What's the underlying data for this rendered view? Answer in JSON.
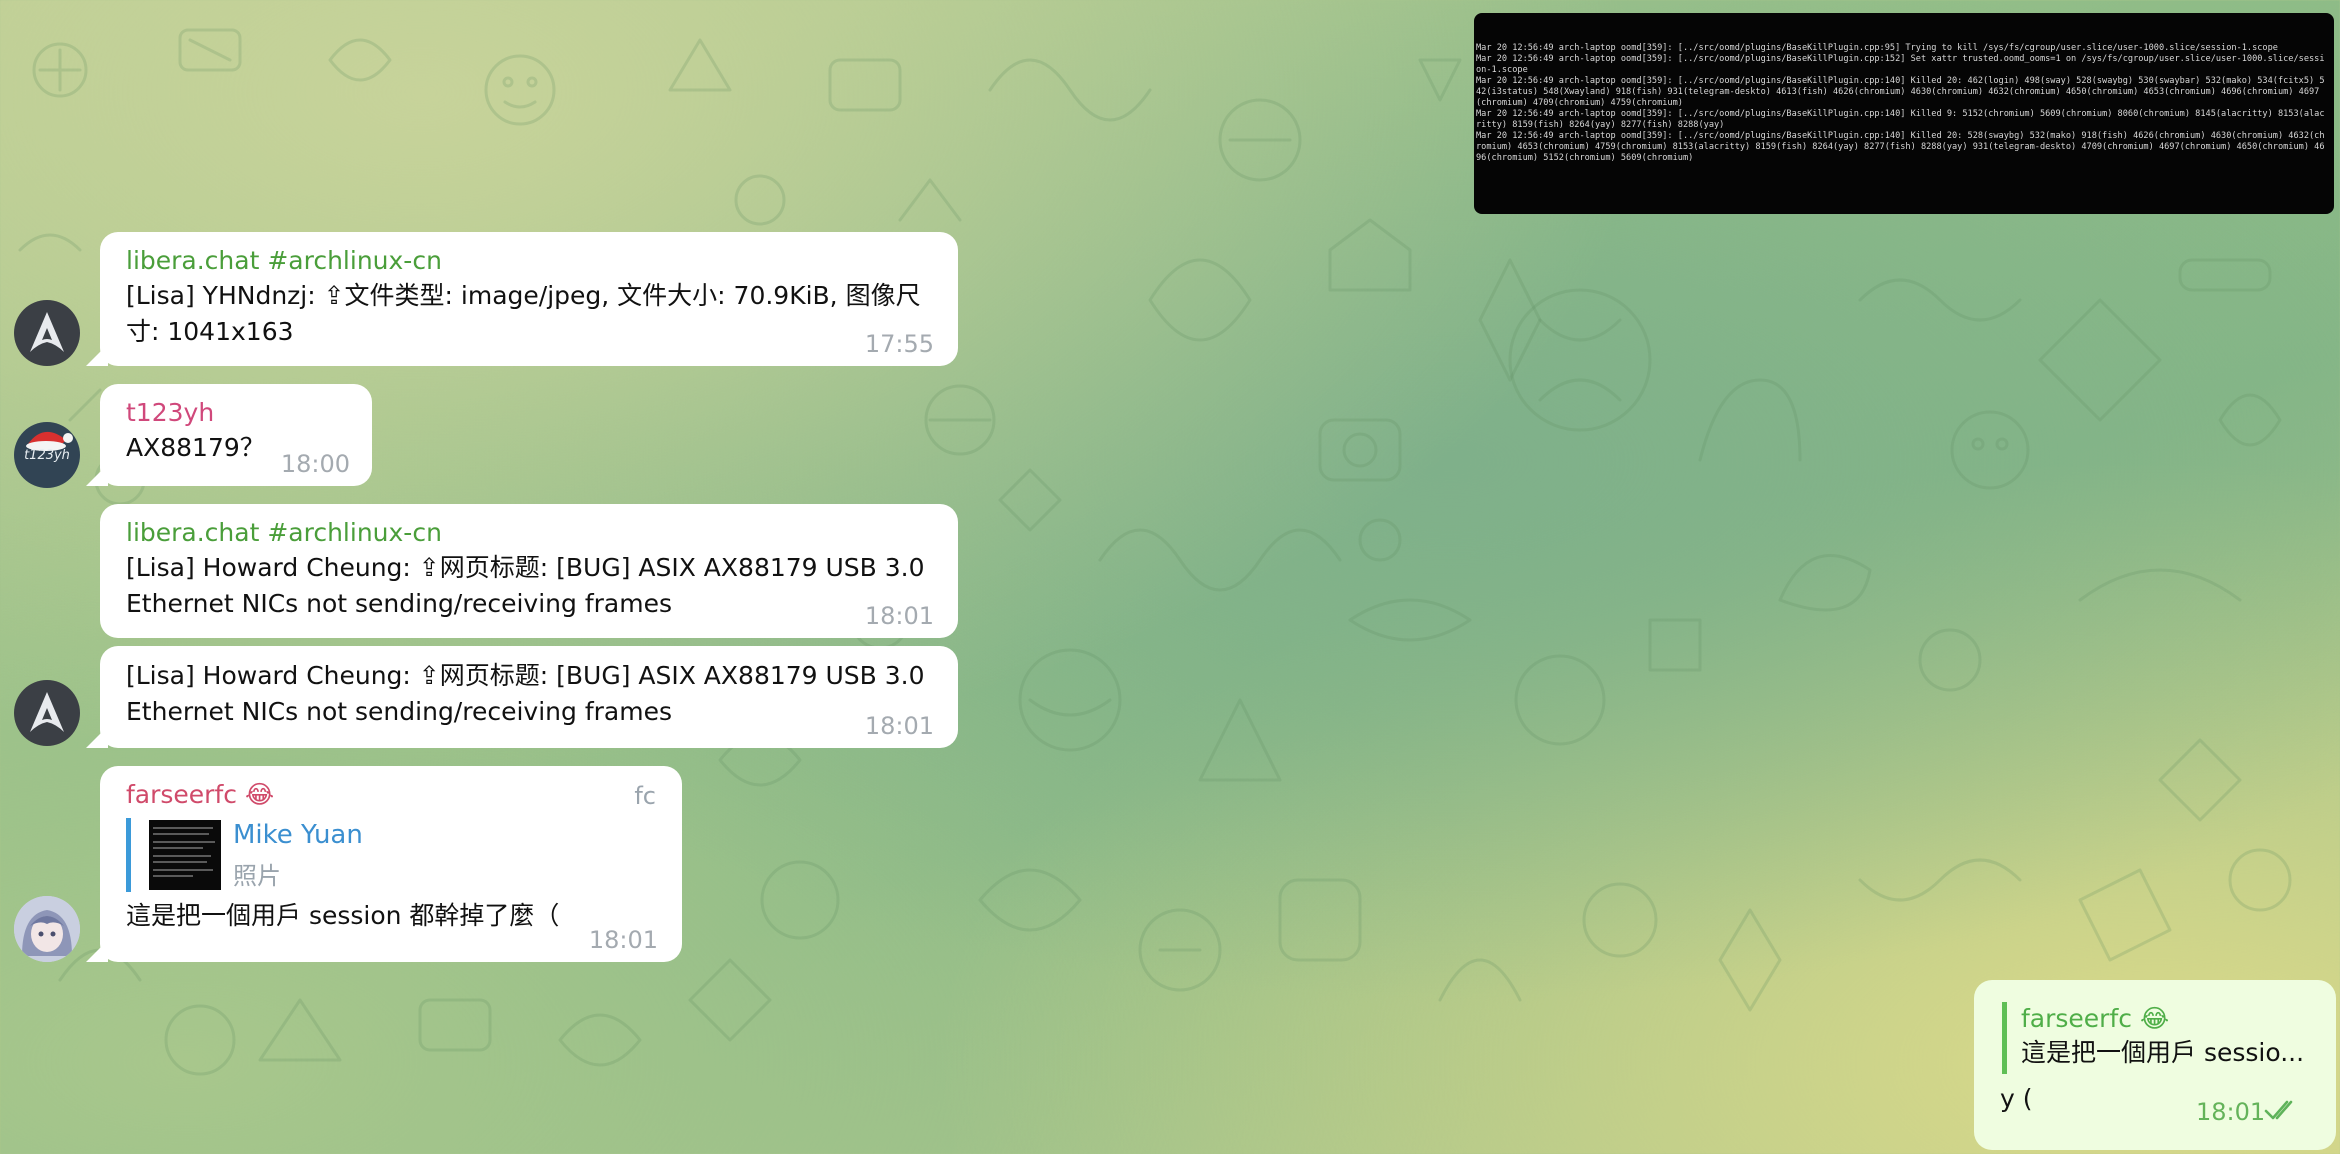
{
  "terminal": {
    "lines": [
      "Mar 20 12:56:49 arch-laptop oomd[359]: [../src/oomd/plugins/BaseKillPlugin.cpp:95] Trying to kill /sys/fs/cgroup/user.slice/user-1000.slice/session-1.scope",
      "Mar 20 12:56:49 arch-laptop oomd[359]: [../src/oomd/plugins/BaseKillPlugin.cpp:152] Set xattr trusted.oomd_ooms=1 on /sys/fs/cgroup/user.slice/user-1000.slice/session-1.scope",
      "Mar 20 12:56:49 arch-laptop oomd[359]: [../src/oomd/plugins/BaseKillPlugin.cpp:140] Killed 20: 462(login) 498(sway) 528(swaybg) 530(swaybar) 532(mako) 534(fcitx5) 542(i3status) 548(Xwayland) 918(fish) 931(telegram-deskto) 4613(fish) 4626(chromium) 4630(chromium) 4632(chromium) 4650(chromium) 4653(chromium) 4696(chromium) 4697(chromium) 4709(chromium) 4759(chromium)",
      "Mar 20 12:56:49 arch-laptop oomd[359]: [../src/oomd/plugins/BaseKillPlugin.cpp:140] Killed 9: 5152(chromium) 5609(chromium) 8060(chromium) 8145(alacritty) 8153(alacritty) 8159(fish) 8264(yay) 8277(fish) 8288(yay)",
      "Mar 20 12:56:49 arch-laptop oomd[359]: [../src/oomd/plugins/BaseKillPlugin.cpp:140] Killed 20: 528(swaybg) 532(mako) 918(fish) 4626(chromium) 4630(chromium) 4632(chromium) 4653(chromium) 4759(chromium) 8153(alacritty) 8159(fish) 8264(yay) 8277(fish) 8288(yay) 931(telegram-deskto) 4709(chromium) 4697(chromium) 4650(chromium) 4696(chromium) 5152(chromium) 5609(chromium)"
    ]
  },
  "messages": [
    {
      "sender": "libera.chat #archlinux-cn",
      "text": "[Lisa] YHNdnzj: ⇪文件类型: image/jpeg, 文件大小: 70.9KiB, 图像尺寸: 1041x163",
      "time": "17:55"
    },
    {
      "sender": "t123yh",
      "avatar_text": "t123yh",
      "text": "AX88179？",
      "time": "18:00"
    },
    {
      "sender": "libera.chat #archlinux-cn",
      "text": "[Lisa] Howard Cheung: ⇪网页标题: [BUG] ASIX AX88179 USB 3.0 Ethernet NICs not sending/receiving frames",
      "time": "18:01"
    },
    {
      "text": "[Lisa] Howard Cheung: ⇪网页标题: [BUG] ASIX AX88179 USB 3.0 Ethernet NICs not sending/receiving frames",
      "time": "18:01"
    },
    {
      "sender": "farseerfc 😂",
      "tag": "fc",
      "quote_name": "Mike Yuan",
      "quote_sub": "照片",
      "text": "這是把一個用戶 session 都幹掉了麼（",
      "time": "18:01"
    }
  ],
  "outgoing": {
    "quote_name": "farseerfc 😂",
    "quote_text": "這是把一個用戶 sessio...",
    "text": "y (",
    "time": "18:01",
    "status_icon": "double-check-icon"
  },
  "colors": {
    "incoming_bubble": "#ffffff",
    "outgoing_bubble": "#effde0",
    "sender_green": "#4a9e3a",
    "sender_pink": "#d0487b",
    "quote_blue": "#3b8fd0",
    "time_gray": "#a4aab0",
    "time_out_green": "#64b35a"
  }
}
